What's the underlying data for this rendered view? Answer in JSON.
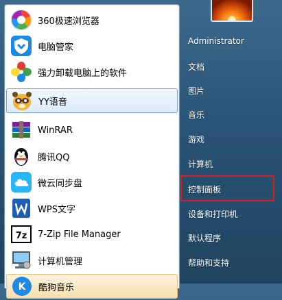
{
  "programs": [
    {
      "label": "360极速浏览器",
      "icon": "360-browser-icon"
    },
    {
      "label": "电脑管家",
      "icon": "pc-manager-shield-icon"
    },
    {
      "label": "强力卸载电脑上的软件",
      "icon": "uninstall-pinwheel-icon"
    },
    {
      "label": "YY语音",
      "icon": "yy-raccoon-icon"
    },
    {
      "label": "WinRAR",
      "icon": "winrar-books-icon"
    },
    {
      "label": "腾讯QQ",
      "icon": "qq-penguin-icon"
    },
    {
      "label": "微云同步盘",
      "icon": "weiyun-cloud-icon"
    },
    {
      "label": "WPS文字",
      "icon": "wps-w-icon"
    },
    {
      "label": "7-Zip File Manager",
      "icon": "7zip-icon"
    },
    {
      "label": "计算机管理",
      "icon": "computer-management-icon"
    },
    {
      "label": "酷狗音乐",
      "icon": "kugou-icon"
    }
  ],
  "right_links": [
    "Administrator",
    "文档",
    "图片",
    "音乐",
    "游戏",
    "计算机",
    "控制面板",
    "设备和打印机",
    "默认程序",
    "帮助和支持"
  ],
  "colors": {
    "highlight_border": "#d81e1e",
    "selected_item_bg": "#ddebf9",
    "right_pane_bg": "#2a5476"
  }
}
